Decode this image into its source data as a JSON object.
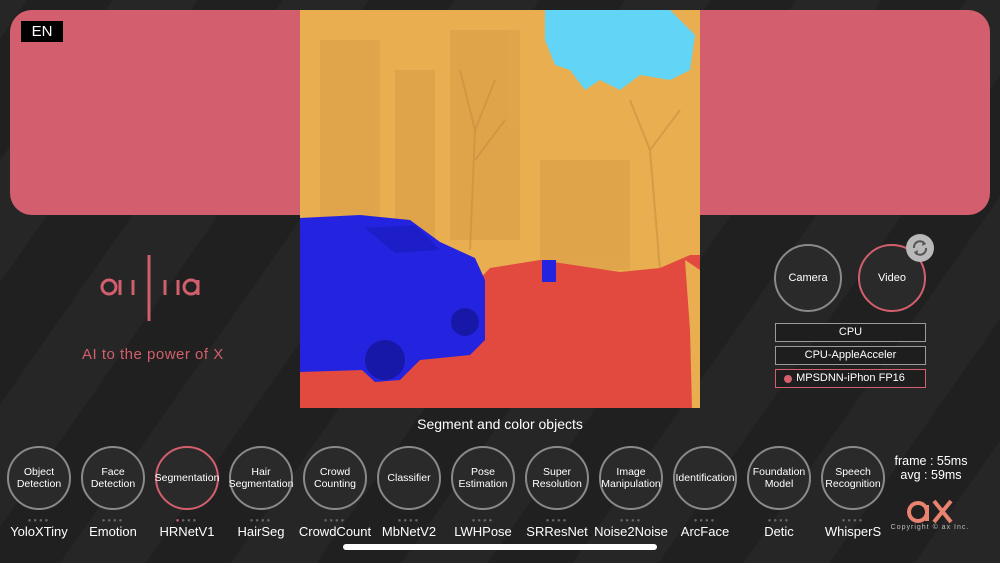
{
  "language": "EN",
  "brand": {
    "tagline": "AI to the power of X",
    "copyright": "Copyright © ax Inc."
  },
  "colors": {
    "accent": "#d35f6e",
    "car_class": "#2323e0",
    "road_class": "#e24a3f",
    "building_class": "#e8ae50",
    "sky_class": "#62d4f5"
  },
  "modes": {
    "camera": "Camera",
    "video": "Video",
    "active": "Video"
  },
  "backends": [
    "CPU",
    "CPU-AppleAcceler",
    "MPSDNN-iPhon FP16"
  ],
  "active_backend": "MPSDNN-iPhon FP16",
  "caption": "Segment and color objects",
  "categories": [
    {
      "label": "Object Detection",
      "model": "YoloXTiny",
      "active": false
    },
    {
      "label": "Face Detection",
      "model": "Emotion",
      "active": false
    },
    {
      "label": "Segmentation",
      "model": "HRNetV1",
      "active": true
    },
    {
      "label": "Hair Segmentation",
      "model": "HairSeg",
      "active": false
    },
    {
      "label": "Crowd Counting",
      "model": "CrowdCount",
      "active": false
    },
    {
      "label": "Classifier",
      "model": "MbNetV2",
      "active": false
    },
    {
      "label": "Pose Estimation",
      "model": "LWHPose",
      "active": false
    },
    {
      "label": "Super Resolution",
      "model": "SRResNet",
      "active": false
    },
    {
      "label": "Image Manipulation",
      "model": "Noise2Noise",
      "active": false
    },
    {
      "label": "Identification",
      "model": "ArcFace",
      "active": false
    },
    {
      "label": "Foundation Model",
      "model": "Detic",
      "active": false
    },
    {
      "label": "Speech Recognition",
      "model": "WhisperS",
      "active": false
    }
  ],
  "stats": {
    "frame": "frame : 55ms",
    "avg": "avg : 59ms"
  },
  "icons": {
    "refresh": "refresh-icon",
    "logo": "ailia-logo",
    "ax": "ax-logo"
  }
}
